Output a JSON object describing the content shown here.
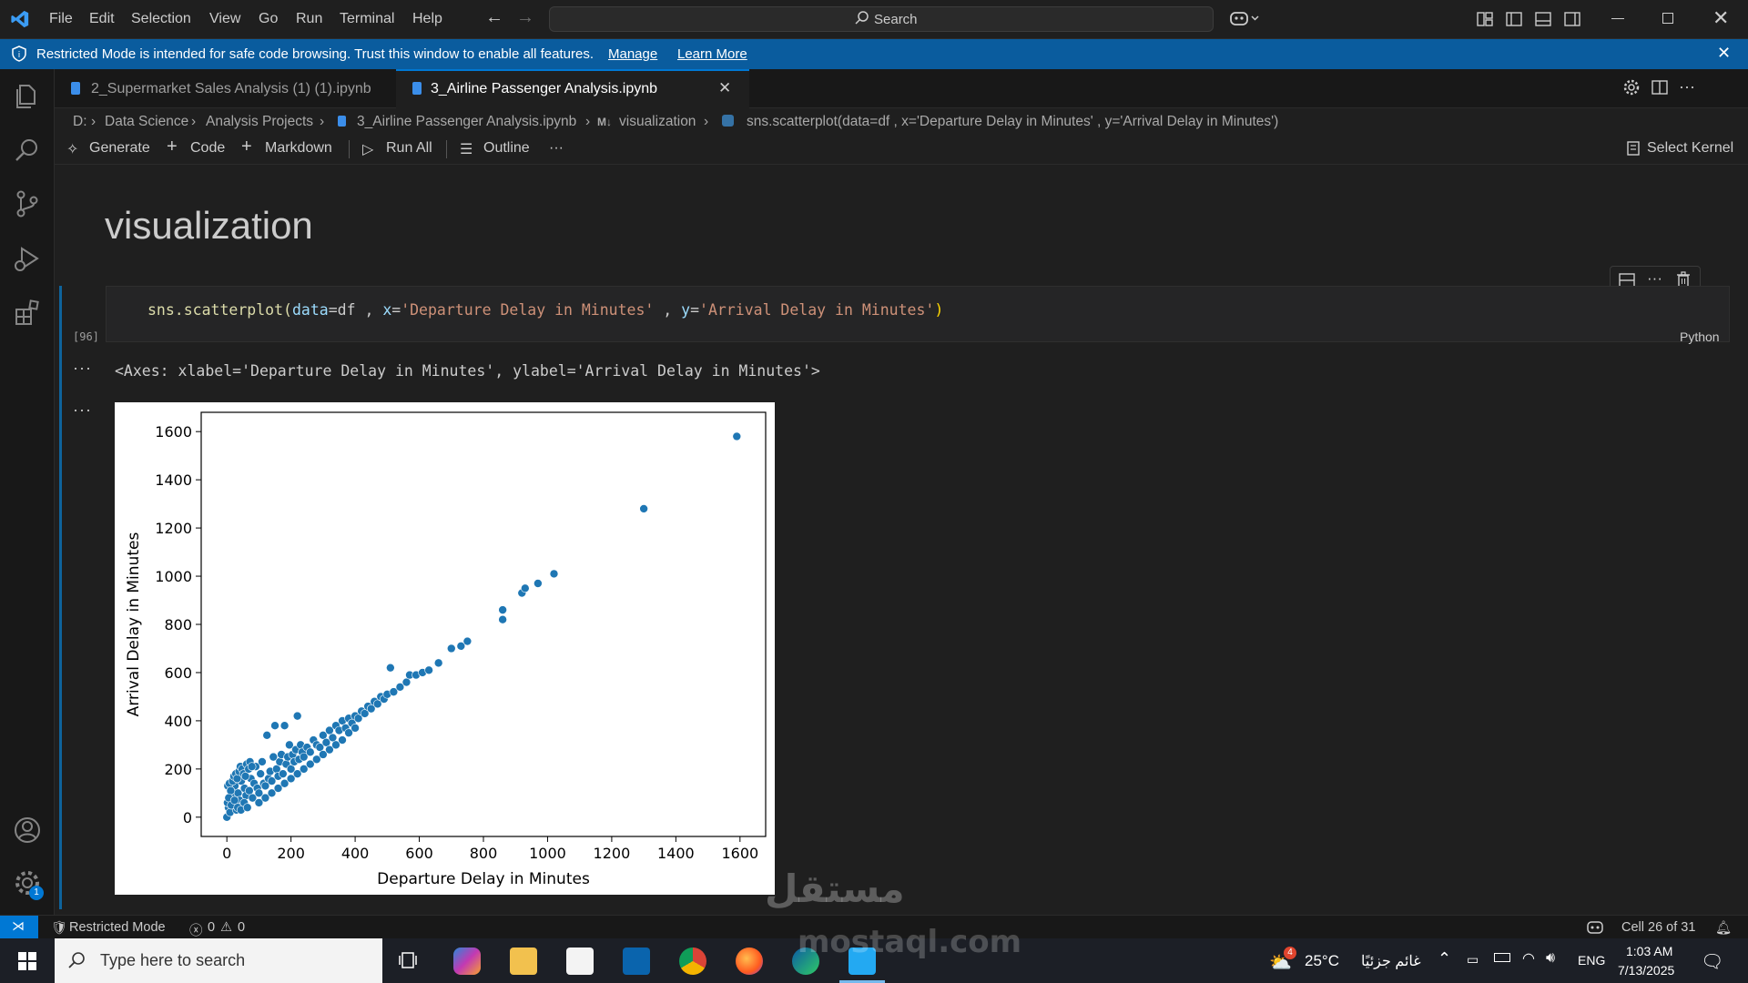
{
  "titlebar": {
    "menu": [
      "File",
      "Edit",
      "Selection",
      "View",
      "Go",
      "Run",
      "Terminal",
      "Help"
    ],
    "search_label": "Search"
  },
  "banner": {
    "message": "Restricted Mode is intended for safe code browsing. Trust this window to enable all features.",
    "manage": "Manage",
    "learn_more": "Learn More"
  },
  "tabs": [
    {
      "label": "2_Supermarket Sales Analysis (1) (1).ipynb",
      "active": false
    },
    {
      "label": "3_Airline Passenger Analysis.ipynb",
      "active": true
    }
  ],
  "breadcrumb": {
    "items": [
      "D:",
      "Data Science",
      "Analysis Projects",
      "3_Airline Passenger Analysis.ipynb",
      "visualization",
      "sns.scatterplot(data=df , x='Departure Delay in Minutes' , y='Arrival Delay in Minutes')"
    ],
    "md_badge": "M↓"
  },
  "toolbar": {
    "generate": "Generate",
    "code": "Code",
    "markdown": "Markdown",
    "run_all": "Run All",
    "outline": "Outline",
    "more": "···",
    "select_kernel": "Select Kernel"
  },
  "notebook": {
    "heading": "visualization",
    "code": {
      "fn": "sns.scatterplot(",
      "arg1": "data",
      "eq1": "=df , ",
      "arg2": "x",
      "eq2": "=",
      "str1": "'Departure Delay in Minutes'",
      "sep": " , ",
      "arg3": "y",
      "eq3": "=",
      "str2": "'Arrival Delay in Minutes'",
      "close": ")"
    },
    "exec_count": "[96]",
    "language": "Python",
    "output_text": "<Axes: xlabel='Departure Delay in Minutes', ylabel='Arrival Delay in Minutes'>",
    "output_dots": "···"
  },
  "chart_data": {
    "type": "scatter",
    "title": "",
    "xlabel": "Departure Delay in Minutes",
    "ylabel": "Arrival Delay in Minutes",
    "xlim": [
      -80,
      1680
    ],
    "ylim": [
      -80,
      1680
    ],
    "xticks": [
      0,
      200,
      400,
      600,
      800,
      1000,
      1200,
      1400,
      1600
    ],
    "yticks": [
      0,
      200,
      400,
      600,
      800,
      1000,
      1200,
      1400,
      1600
    ],
    "grid": false,
    "color": "#1f77b4",
    "points": [
      [
        0,
        0
      ],
      [
        5,
        40
      ],
      [
        10,
        20
      ],
      [
        15,
        90
      ],
      [
        20,
        60
      ],
      [
        25,
        130
      ],
      [
        30,
        30
      ],
      [
        35,
        100
      ],
      [
        40,
        70
      ],
      [
        45,
        150
      ],
      [
        50,
        50
      ],
      [
        55,
        120
      ],
      [
        60,
        90
      ],
      [
        65,
        200
      ],
      [
        70,
        110
      ],
      [
        75,
        160
      ],
      [
        80,
        80
      ],
      [
        85,
        140
      ],
      [
        90,
        210
      ],
      [
        95,
        120
      ],
      [
        100,
        100
      ],
      [
        105,
        180
      ],
      [
        110,
        230
      ],
      [
        115,
        140
      ],
      [
        120,
        130
      ],
      [
        125,
        340
      ],
      [
        130,
        160
      ],
      [
        135,
        190
      ],
      [
        140,
        150
      ],
      [
        145,
        250
      ],
      [
        150,
        380
      ],
      [
        155,
        200
      ],
      [
        160,
        170
      ],
      [
        165,
        230
      ],
      [
        170,
        260
      ],
      [
        175,
        180
      ],
      [
        180,
        380
      ],
      [
        185,
        220
      ],
      [
        190,
        250
      ],
      [
        195,
        300
      ],
      [
        200,
        200
      ],
      [
        205,
        260
      ],
      [
        210,
        230
      ],
      [
        215,
        280
      ],
      [
        220,
        420
      ],
      [
        225,
        240
      ],
      [
        230,
        300
      ],
      [
        235,
        270
      ],
      [
        240,
        250
      ],
      [
        250,
        290
      ],
      [
        260,
        270
      ],
      [
        270,
        320
      ],
      [
        280,
        300
      ],
      [
        290,
        290
      ],
      [
        300,
        340
      ],
      [
        310,
        310
      ],
      [
        320,
        360
      ],
      [
        330,
        330
      ],
      [
        340,
        380
      ],
      [
        350,
        360
      ],
      [
        360,
        400
      ],
      [
        370,
        370
      ],
      [
        380,
        410
      ],
      [
        390,
        390
      ],
      [
        400,
        420
      ],
      [
        410,
        410
      ],
      [
        420,
        440
      ],
      [
        430,
        430
      ],
      [
        440,
        460
      ],
      [
        450,
        450
      ],
      [
        460,
        480
      ],
      [
        470,
        470
      ],
      [
        480,
        500
      ],
      [
        490,
        490
      ],
      [
        500,
        510
      ],
      [
        510,
        620
      ],
      [
        520,
        520
      ],
      [
        540,
        540
      ],
      [
        560,
        560
      ],
      [
        570,
        590
      ],
      [
        590,
        590
      ],
      [
        610,
        600
      ],
      [
        630,
        610
      ],
      [
        660,
        640
      ],
      [
        700,
        700
      ],
      [
        730,
        710
      ],
      [
        750,
        730
      ],
      [
        860,
        820
      ],
      [
        860,
        860
      ],
      [
        920,
        930
      ],
      [
        930,
        950
      ],
      [
        970,
        970
      ],
      [
        1020,
        1010
      ],
      [
        1300,
        1280
      ],
      [
        1590,
        1580
      ],
      [
        3,
        130
      ],
      [
        8,
        140
      ],
      [
        12,
        110
      ],
      [
        18,
        150
      ],
      [
        22,
        170
      ],
      [
        28,
        180
      ],
      [
        32,
        160
      ],
      [
        38,
        190
      ],
      [
        42,
        210
      ],
      [
        48,
        200
      ],
      [
        52,
        180
      ],
      [
        58,
        170
      ],
      [
        62,
        220
      ],
      [
        68,
        200
      ],
      [
        72,
        230
      ],
      [
        78,
        210
      ],
      [
        2,
        60
      ],
      [
        6,
        80
      ],
      [
        14,
        50
      ],
      [
        24,
        70
      ],
      [
        34,
        40
      ],
      [
        44,
        30
      ],
      [
        54,
        60
      ],
      [
        64,
        40
      ],
      [
        100,
        60
      ],
      [
        120,
        80
      ],
      [
        140,
        100
      ],
      [
        160,
        120
      ],
      [
        180,
        140
      ],
      [
        200,
        160
      ],
      [
        220,
        180
      ],
      [
        240,
        200
      ],
      [
        260,
        220
      ],
      [
        280,
        240
      ],
      [
        300,
        260
      ],
      [
        320,
        280
      ],
      [
        340,
        300
      ],
      [
        360,
        320
      ],
      [
        380,
        350
      ],
      [
        400,
        370
      ]
    ]
  },
  "statusbar": {
    "restricted": "Restricted Mode",
    "errors": "0",
    "warnings": "0",
    "cell": "Cell 26 of 31"
  },
  "taskbar": {
    "search_placeholder": "Type here to search",
    "weather": "25°C",
    "weather_desc": "غائم جزئيًا",
    "lang": "ENG",
    "time": "1:03 AM",
    "date": "7/13/2025",
    "weather_badge": "4"
  },
  "watermark": {
    "arabic": "مستقل",
    "latin": "mostaql.com"
  },
  "colors": {
    "accent": "#0078d4",
    "banner": "#0a5c9e",
    "code_fn": "#dcdcaa",
    "code_param": "#9cdcfe",
    "code_string": "#ce9178",
    "paren": "#ffd700"
  }
}
